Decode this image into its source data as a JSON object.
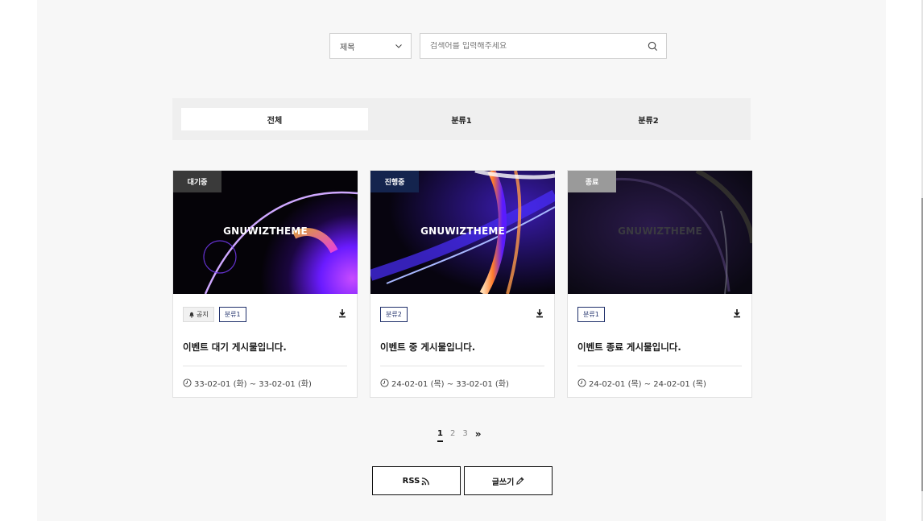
{
  "search": {
    "field_select": "제목",
    "placeholder": "검색어를 입력해주세요"
  },
  "tabs": [
    {
      "label": "전체",
      "active": true
    },
    {
      "label": "분류1",
      "active": false
    },
    {
      "label": "분류2",
      "active": false
    }
  ],
  "cards": [
    {
      "status": "대기중",
      "image_text": "GNUWIZTHEME",
      "notice_label": "공지",
      "category": "분류1",
      "title": "이벤트 대기 게시물입니다.",
      "period": "33-02-01 (화) ~ 33-02-01 (화)"
    },
    {
      "status": "진행중",
      "image_text": "GNUWIZTHEME",
      "category": "분류2",
      "title": "이벤트 중 게시물입니다.",
      "period": "24-02-01 (목) ~ 33-02-01 (화)"
    },
    {
      "status": "종료",
      "image_text": "GNUWIZTHEME",
      "category": "분류1",
      "title": "이벤트 종료 게시물입니다.",
      "period": "24-02-01 (목) ~ 24-02-01 (목)"
    }
  ],
  "pagination": {
    "pages": [
      "1",
      "2",
      "3"
    ],
    "current": "1",
    "next": "»"
  },
  "actions": {
    "rss_label": "RSS",
    "write_label": "글쓰기"
  },
  "colors": {
    "status_wait": "#3a3a3a",
    "status_live": "#14244e",
    "status_end": "#9a9a9a",
    "category_accent": "#1f2f6a"
  }
}
